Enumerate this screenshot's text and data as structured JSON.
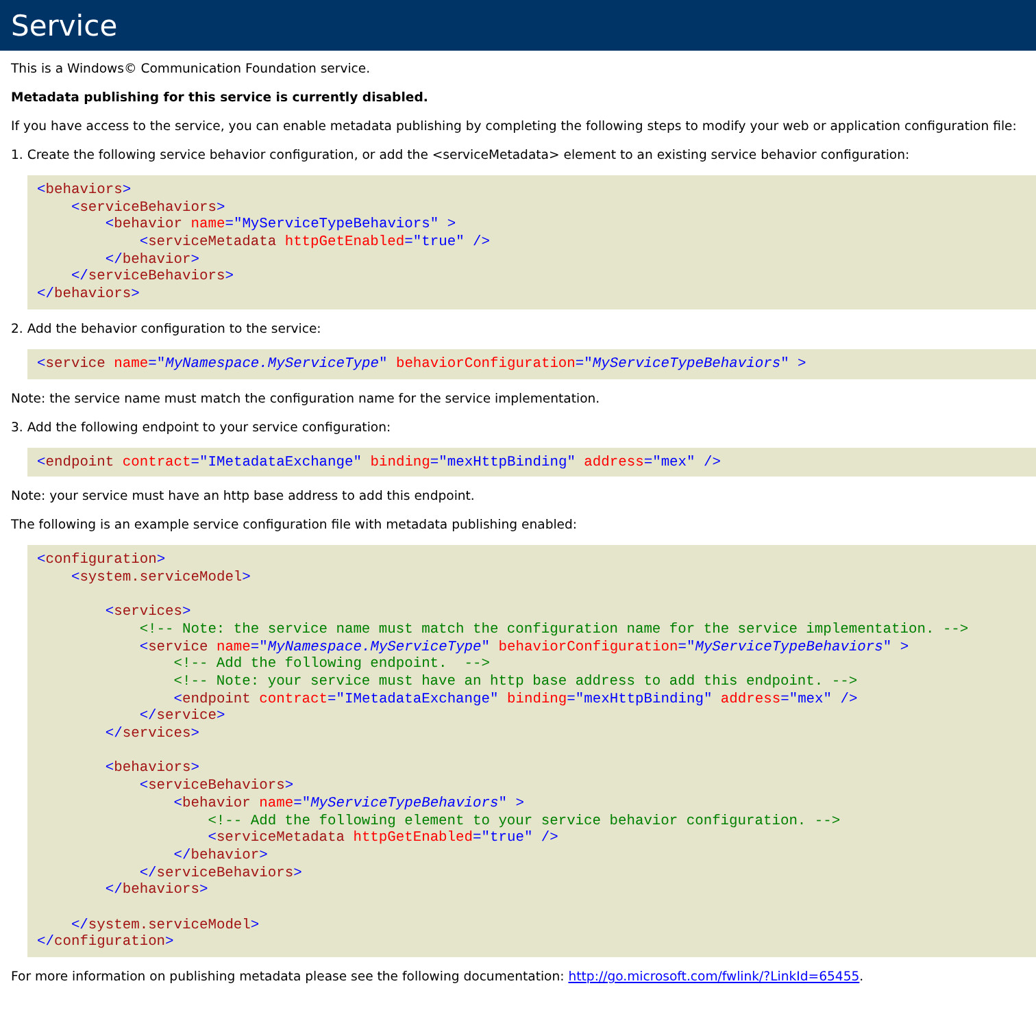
{
  "header": {
    "title": "Service"
  },
  "content": [
    {
      "kind": "text",
      "text": "This is a Windows© Communication Foundation service."
    },
    {
      "kind": "strong",
      "text": "Metadata publishing for this service is currently disabled."
    },
    {
      "kind": "text",
      "text": "If you have access to the service, you can enable metadata publishing by completing the following steps to modify your web or application configuration file:"
    },
    {
      "kind": "text",
      "text": "1. Create the following service behavior configuration, or add the <serviceMetadata> element to an existing service behavior configuration:"
    },
    {
      "kind": "code",
      "nodes": [
        {
          "kind": "element",
          "line": [
            {
              "kind": "punct",
              "text": "<"
            },
            {
              "kind": "tag",
              "text": "behaviors"
            },
            {
              "kind": "punct",
              "text": ">"
            }
          ],
          "close": [
            {
              "kind": "punct",
              "text": "</"
            },
            {
              "kind": "tag",
              "text": "behaviors"
            },
            {
              "kind": "punct",
              "text": ">"
            }
          ],
          "children": [
            {
              "kind": "element",
              "line": [
                {
                  "kind": "punct",
                  "text": "<"
                },
                {
                  "kind": "tag",
                  "text": "serviceBehaviors"
                },
                {
                  "kind": "punct",
                  "text": ">"
                }
              ],
              "close": [
                {
                  "kind": "punct",
                  "text": "</"
                },
                {
                  "kind": "tag",
                  "text": "serviceBehaviors"
                },
                {
                  "kind": "punct",
                  "text": ">"
                }
              ],
              "children": [
                {
                  "kind": "element",
                  "line": [
                    {
                      "kind": "punct",
                      "text": "<"
                    },
                    {
                      "kind": "tag",
                      "text": "behavior"
                    },
                    {
                      "kind": "attr",
                      "text": " name"
                    },
                    {
                      "kind": "punct",
                      "text": "=\""
                    },
                    {
                      "kind": "value",
                      "text": "MyServiceTypeBehaviors"
                    },
                    {
                      "kind": "punct",
                      "text": "\" >"
                    }
                  ],
                  "close": [
                    {
                      "kind": "punct",
                      "text": "</"
                    },
                    {
                      "kind": "tag",
                      "text": "behavior"
                    },
                    {
                      "kind": "punct",
                      "text": ">"
                    }
                  ],
                  "children": [
                    {
                      "kind": "line",
                      "line": [
                        {
                          "kind": "punct",
                          "text": "<"
                        },
                        {
                          "kind": "tag",
                          "text": "serviceMetadata"
                        },
                        {
                          "kind": "attr",
                          "text": " httpGetEnabled"
                        },
                        {
                          "kind": "punct",
                          "text": "=\""
                        },
                        {
                          "kind": "value",
                          "text": "true"
                        },
                        {
                          "kind": "punct",
                          "text": "\" />"
                        }
                      ]
                    }
                  ]
                }
              ]
            }
          ]
        }
      ]
    },
    {
      "kind": "text",
      "text": "2. Add the behavior configuration to the service:"
    },
    {
      "kind": "code",
      "nodes": [
        {
          "kind": "line",
          "line": [
            {
              "kind": "punct",
              "text": "<"
            },
            {
              "kind": "tag",
              "text": "service"
            },
            {
              "kind": "attr",
              "text": " name"
            },
            {
              "kind": "punct",
              "text": "=\""
            },
            {
              "kind": "ivalue",
              "text": "MyNamespace.MyServiceType"
            },
            {
              "kind": "punct",
              "text": "\""
            },
            {
              "kind": "attr",
              "text": " behaviorConfiguration"
            },
            {
              "kind": "punct",
              "text": "=\""
            },
            {
              "kind": "ivalue",
              "text": "MyServiceTypeBehaviors"
            },
            {
              "kind": "punct",
              "text": "\" >"
            }
          ]
        }
      ]
    },
    {
      "kind": "text",
      "text": "Note: the service name must match the configuration name for the service implementation."
    },
    {
      "kind": "text",
      "text": "3. Add the following endpoint to your service configuration:"
    },
    {
      "kind": "code",
      "nodes": [
        {
          "kind": "line",
          "line": [
            {
              "kind": "punct",
              "text": "<"
            },
            {
              "kind": "tag",
              "text": "endpoint"
            },
            {
              "kind": "attr",
              "text": " contract"
            },
            {
              "kind": "punct",
              "text": "=\""
            },
            {
              "kind": "value",
              "text": "IMetadataExchange"
            },
            {
              "kind": "punct",
              "text": "\""
            },
            {
              "kind": "attr",
              "text": " binding"
            },
            {
              "kind": "punct",
              "text": "=\""
            },
            {
              "kind": "value",
              "text": "mexHttpBinding"
            },
            {
              "kind": "punct",
              "text": "\""
            },
            {
              "kind": "attr",
              "text": " address"
            },
            {
              "kind": "punct",
              "text": "=\""
            },
            {
              "kind": "value",
              "text": "mex"
            },
            {
              "kind": "punct",
              "text": "\" />"
            }
          ]
        }
      ]
    },
    {
      "kind": "text",
      "text": "Note: your service must have an http base address to add this endpoint."
    },
    {
      "kind": "text",
      "text": "The following is an example service configuration file with metadata publishing enabled:"
    },
    {
      "kind": "code",
      "nodes": [
        {
          "kind": "element",
          "line": [
            {
              "kind": "punct",
              "text": "<"
            },
            {
              "kind": "tag",
              "text": "configuration"
            },
            {
              "kind": "punct",
              "text": ">"
            }
          ],
          "close": [
            {
              "kind": "punct",
              "text": "</"
            },
            {
              "kind": "tag",
              "text": "configuration"
            },
            {
              "kind": "punct",
              "text": ">"
            }
          ],
          "children": [
            {
              "kind": "element",
              "line": [
                {
                  "kind": "punct",
                  "text": "<"
                },
                {
                  "kind": "tag",
                  "text": "system.serviceModel"
                },
                {
                  "kind": "punct",
                  "text": ">"
                }
              ],
              "close": [
                {
                  "kind": "punct",
                  "text": "</"
                },
                {
                  "kind": "tag",
                  "text": "system.serviceModel"
                },
                {
                  "kind": "punct",
                  "text": ">"
                }
              ],
              "children": [
                {
                  "kind": "blank"
                },
                {
                  "kind": "element",
                  "line": [
                    {
                      "kind": "punct",
                      "text": "<"
                    },
                    {
                      "kind": "tag",
                      "text": "services"
                    },
                    {
                      "kind": "punct",
                      "text": ">"
                    }
                  ],
                  "close": [
                    {
                      "kind": "punct",
                      "text": "</"
                    },
                    {
                      "kind": "tag",
                      "text": "services"
                    },
                    {
                      "kind": "punct",
                      "text": ">"
                    }
                  ],
                  "children": [
                    {
                      "kind": "line",
                      "line": [
                        {
                          "kind": "comment",
                          "text": "<!-- Note: the service name must match the configuration name for the service implementation. -->"
                        }
                      ]
                    },
                    {
                      "kind": "element",
                      "line": [
                        {
                          "kind": "punct",
                          "text": "<"
                        },
                        {
                          "kind": "tag",
                          "text": "service"
                        },
                        {
                          "kind": "attr",
                          "text": " name"
                        },
                        {
                          "kind": "punct",
                          "text": "=\""
                        },
                        {
                          "kind": "ivalue",
                          "text": "MyNamespace.MyServiceType"
                        },
                        {
                          "kind": "punct",
                          "text": "\""
                        },
                        {
                          "kind": "attr",
                          "text": " behaviorConfiguration"
                        },
                        {
                          "kind": "punct",
                          "text": "=\""
                        },
                        {
                          "kind": "ivalue",
                          "text": "MyServiceTypeBehaviors"
                        },
                        {
                          "kind": "punct",
                          "text": "\" >"
                        }
                      ],
                      "close": [
                        {
                          "kind": "punct",
                          "text": "</"
                        },
                        {
                          "kind": "tag",
                          "text": "service"
                        },
                        {
                          "kind": "punct",
                          "text": ">"
                        }
                      ],
                      "children": [
                        {
                          "kind": "line",
                          "line": [
                            {
                              "kind": "comment",
                              "text": "<!-- Add the following endpoint.  -->"
                            }
                          ]
                        },
                        {
                          "kind": "line",
                          "line": [
                            {
                              "kind": "comment",
                              "text": "<!-- Note: your service must have an http base address to add this endpoint. -->"
                            }
                          ]
                        },
                        {
                          "kind": "line",
                          "line": [
                            {
                              "kind": "punct",
                              "text": "<"
                            },
                            {
                              "kind": "tag",
                              "text": "endpoint"
                            },
                            {
                              "kind": "attr",
                              "text": " contract"
                            },
                            {
                              "kind": "punct",
                              "text": "=\""
                            },
                            {
                              "kind": "value",
                              "text": "IMetadataExchange"
                            },
                            {
                              "kind": "punct",
                              "text": "\""
                            },
                            {
                              "kind": "attr",
                              "text": " binding"
                            },
                            {
                              "kind": "punct",
                              "text": "=\""
                            },
                            {
                              "kind": "value",
                              "text": "mexHttpBinding"
                            },
                            {
                              "kind": "punct",
                              "text": "\""
                            },
                            {
                              "kind": "attr",
                              "text": " address"
                            },
                            {
                              "kind": "punct",
                              "text": "=\""
                            },
                            {
                              "kind": "value",
                              "text": "mex"
                            },
                            {
                              "kind": "punct",
                              "text": "\" />"
                            }
                          ]
                        }
                      ]
                    }
                  ]
                },
                {
                  "kind": "blank"
                },
                {
                  "kind": "element",
                  "line": [
                    {
                      "kind": "punct",
                      "text": "<"
                    },
                    {
                      "kind": "tag",
                      "text": "behaviors"
                    },
                    {
                      "kind": "punct",
                      "text": ">"
                    }
                  ],
                  "close": [
                    {
                      "kind": "punct",
                      "text": "</"
                    },
                    {
                      "kind": "tag",
                      "text": "behaviors"
                    },
                    {
                      "kind": "punct",
                      "text": ">"
                    }
                  ],
                  "children": [
                    {
                      "kind": "element",
                      "line": [
                        {
                          "kind": "punct",
                          "text": "<"
                        },
                        {
                          "kind": "tag",
                          "text": "serviceBehaviors"
                        },
                        {
                          "kind": "punct",
                          "text": ">"
                        }
                      ],
                      "close": [
                        {
                          "kind": "punct",
                          "text": "</"
                        },
                        {
                          "kind": "tag",
                          "text": "serviceBehaviors"
                        },
                        {
                          "kind": "punct",
                          "text": ">"
                        }
                      ],
                      "children": [
                        {
                          "kind": "element",
                          "line": [
                            {
                              "kind": "punct",
                              "text": "<"
                            },
                            {
                              "kind": "tag",
                              "text": "behavior"
                            },
                            {
                              "kind": "attr",
                              "text": " name"
                            },
                            {
                              "kind": "punct",
                              "text": "=\""
                            },
                            {
                              "kind": "ivalue",
                              "text": "MyServiceTypeBehaviors"
                            },
                            {
                              "kind": "punct",
                              "text": "\" >"
                            }
                          ],
                          "close": [
                            {
                              "kind": "punct",
                              "text": "</"
                            },
                            {
                              "kind": "tag",
                              "text": "behavior"
                            },
                            {
                              "kind": "punct",
                              "text": ">"
                            }
                          ],
                          "children": [
                            {
                              "kind": "line",
                              "line": [
                                {
                                  "kind": "comment",
                                  "text": "<!-- Add the following element to your service behavior configuration. -->"
                                }
                              ]
                            },
                            {
                              "kind": "line",
                              "line": [
                                {
                                  "kind": "punct",
                                  "text": "<"
                                },
                                {
                                  "kind": "tag",
                                  "text": "serviceMetadata"
                                },
                                {
                                  "kind": "attr",
                                  "text": " httpGetEnabled"
                                },
                                {
                                  "kind": "punct",
                                  "text": "=\""
                                },
                                {
                                  "kind": "value",
                                  "text": "true"
                                },
                                {
                                  "kind": "punct",
                                  "text": "\" />"
                                }
                              ]
                            }
                          ]
                        }
                      ]
                    }
                  ]
                },
                {
                  "kind": "blank"
                }
              ]
            }
          ]
        }
      ]
    },
    {
      "kind": "link",
      "text": "For more information on publishing metadata please see the following documentation: ",
      "link": "http://go.microsoft.com/fwlink/?LinkId=65455",
      "after": "."
    }
  ]
}
